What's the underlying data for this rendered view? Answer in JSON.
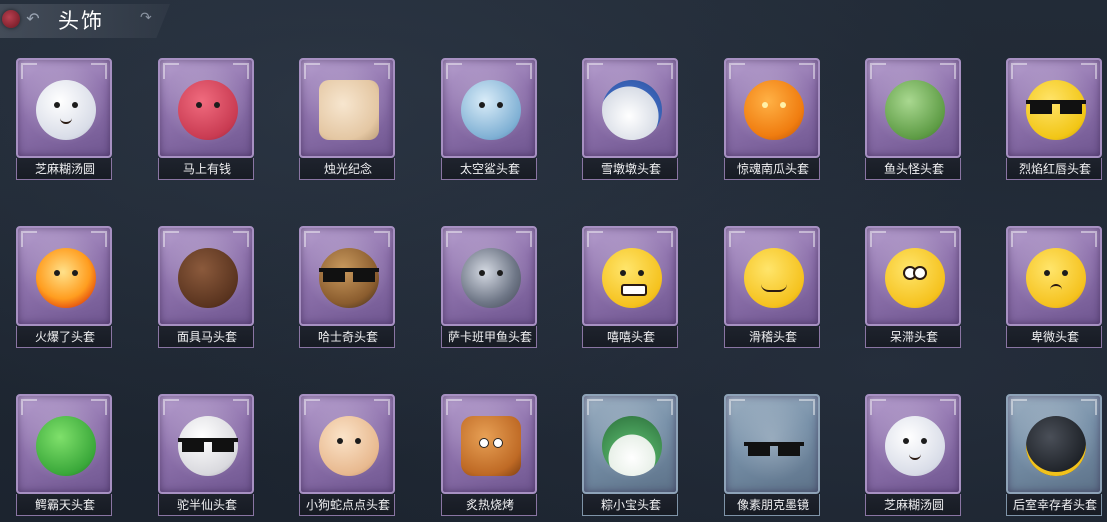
{
  "header": {
    "title": "头饰",
    "back_icon": "back-arrow-icon",
    "badge_icon": "rose-emblem-icon",
    "decor_icon": "swirl-ornament-icon"
  },
  "items": [
    {
      "label": "芝麻糊汤圆",
      "rarity": "purple"
    },
    {
      "label": "马上有钱",
      "rarity": "purple"
    },
    {
      "label": "烛光纪念",
      "rarity": "purple"
    },
    {
      "label": "太空鲨头套",
      "rarity": "purple"
    },
    {
      "label": "雪墩墩头套",
      "rarity": "purple"
    },
    {
      "label": "惊魂南瓜头套",
      "rarity": "purple"
    },
    {
      "label": "鱼头怪头套",
      "rarity": "purple"
    },
    {
      "label": "烈焰红唇头套",
      "rarity": "purple"
    },
    {
      "label": "火爆了头套",
      "rarity": "purple"
    },
    {
      "label": "面具马头套",
      "rarity": "purple"
    },
    {
      "label": "哈士奇头套",
      "rarity": "purple"
    },
    {
      "label": "萨卡班甲鱼头套",
      "rarity": "purple"
    },
    {
      "label": "嘻嘻头套",
      "rarity": "purple"
    },
    {
      "label": "滑稽头套",
      "rarity": "purple"
    },
    {
      "label": "呆滞头套",
      "rarity": "purple"
    },
    {
      "label": "卑微头套",
      "rarity": "purple"
    },
    {
      "label": "鳄霸天头套",
      "rarity": "purple"
    },
    {
      "label": "驼半仙头套",
      "rarity": "purple"
    },
    {
      "label": "小狗蛇点点头套",
      "rarity": "purple"
    },
    {
      "label": "炙热烧烤",
      "rarity": "purple"
    },
    {
      "label": "粽小宝头套",
      "rarity": "blue"
    },
    {
      "label": "像素朋克墨镜",
      "rarity": "blue"
    },
    {
      "label": "芝麻糊汤圆",
      "rarity": "purple"
    },
    {
      "label": "后室幸存者头套",
      "rarity": "blue"
    }
  ],
  "colors": {
    "rarity_purple": "#9a7fba",
    "rarity_blue": "#7b91a8",
    "background": "#1f2733",
    "label_text": "#f1f1f3"
  }
}
